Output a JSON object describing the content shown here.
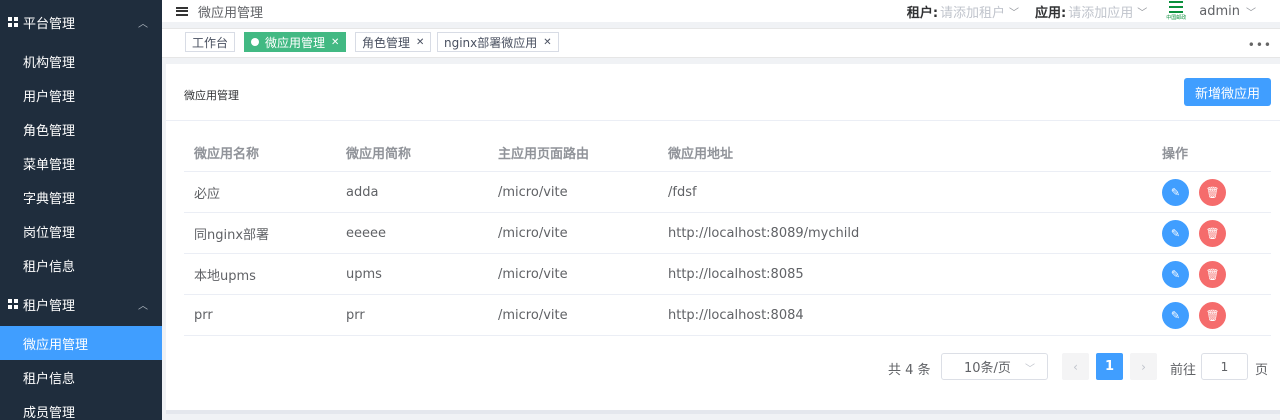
{
  "sidebar": {
    "groups": [
      {
        "label": "平台管理",
        "items": [
          "机构管理",
          "用户管理",
          "角色管理",
          "菜单管理",
          "字典管理",
          "岗位管理",
          "租户信息"
        ]
      },
      {
        "label": "租户管理",
        "items": [
          "微应用管理",
          "租户信息",
          "成员管理"
        ]
      }
    ],
    "active_item": "微应用管理"
  },
  "header": {
    "title": "微应用管理",
    "tenant_label": "租户:",
    "tenant_placeholder": "请添加租户",
    "app_label": "应用:",
    "app_placeholder": "请添加应用",
    "logo_text": "中国邮政",
    "user": "admin"
  },
  "tags": [
    {
      "label": "工作台",
      "active": false,
      "closable": false
    },
    {
      "label": "微应用管理",
      "active": true,
      "closable": true
    },
    {
      "label": "角色管理",
      "active": false,
      "closable": true
    },
    {
      "label": "nginx部署微应用",
      "active": false,
      "closable": true
    }
  ],
  "card": {
    "title": "微应用管理",
    "add_button": "新增微应用"
  },
  "table": {
    "columns": [
      "微应用名称",
      "微应用简称",
      "主应用页面路由",
      "微应用地址",
      "操作"
    ],
    "rows": [
      [
        "必应",
        "adda",
        "/micro/vite",
        "/fdsf"
      ],
      [
        "同nginx部署",
        "eeeee",
        "/micro/vite",
        "http://localhost:8089/mychild"
      ],
      [
        "本地upms",
        "upms",
        "/micro/vite",
        "http://localhost:8085"
      ],
      [
        "prr",
        "prr",
        "/micro/vite",
        "http://localhost:8084"
      ]
    ]
  },
  "pagination": {
    "total_text": "共 4 条",
    "page_size": "10条/页",
    "current_page": "1",
    "goto_label": "前往",
    "goto_value": "1",
    "page_unit": "页"
  },
  "colors": {
    "sidebar_bg": "#1f2d3d",
    "accent": "#409eff",
    "tag_active": "#42b983",
    "danger": "#f56c6c"
  }
}
